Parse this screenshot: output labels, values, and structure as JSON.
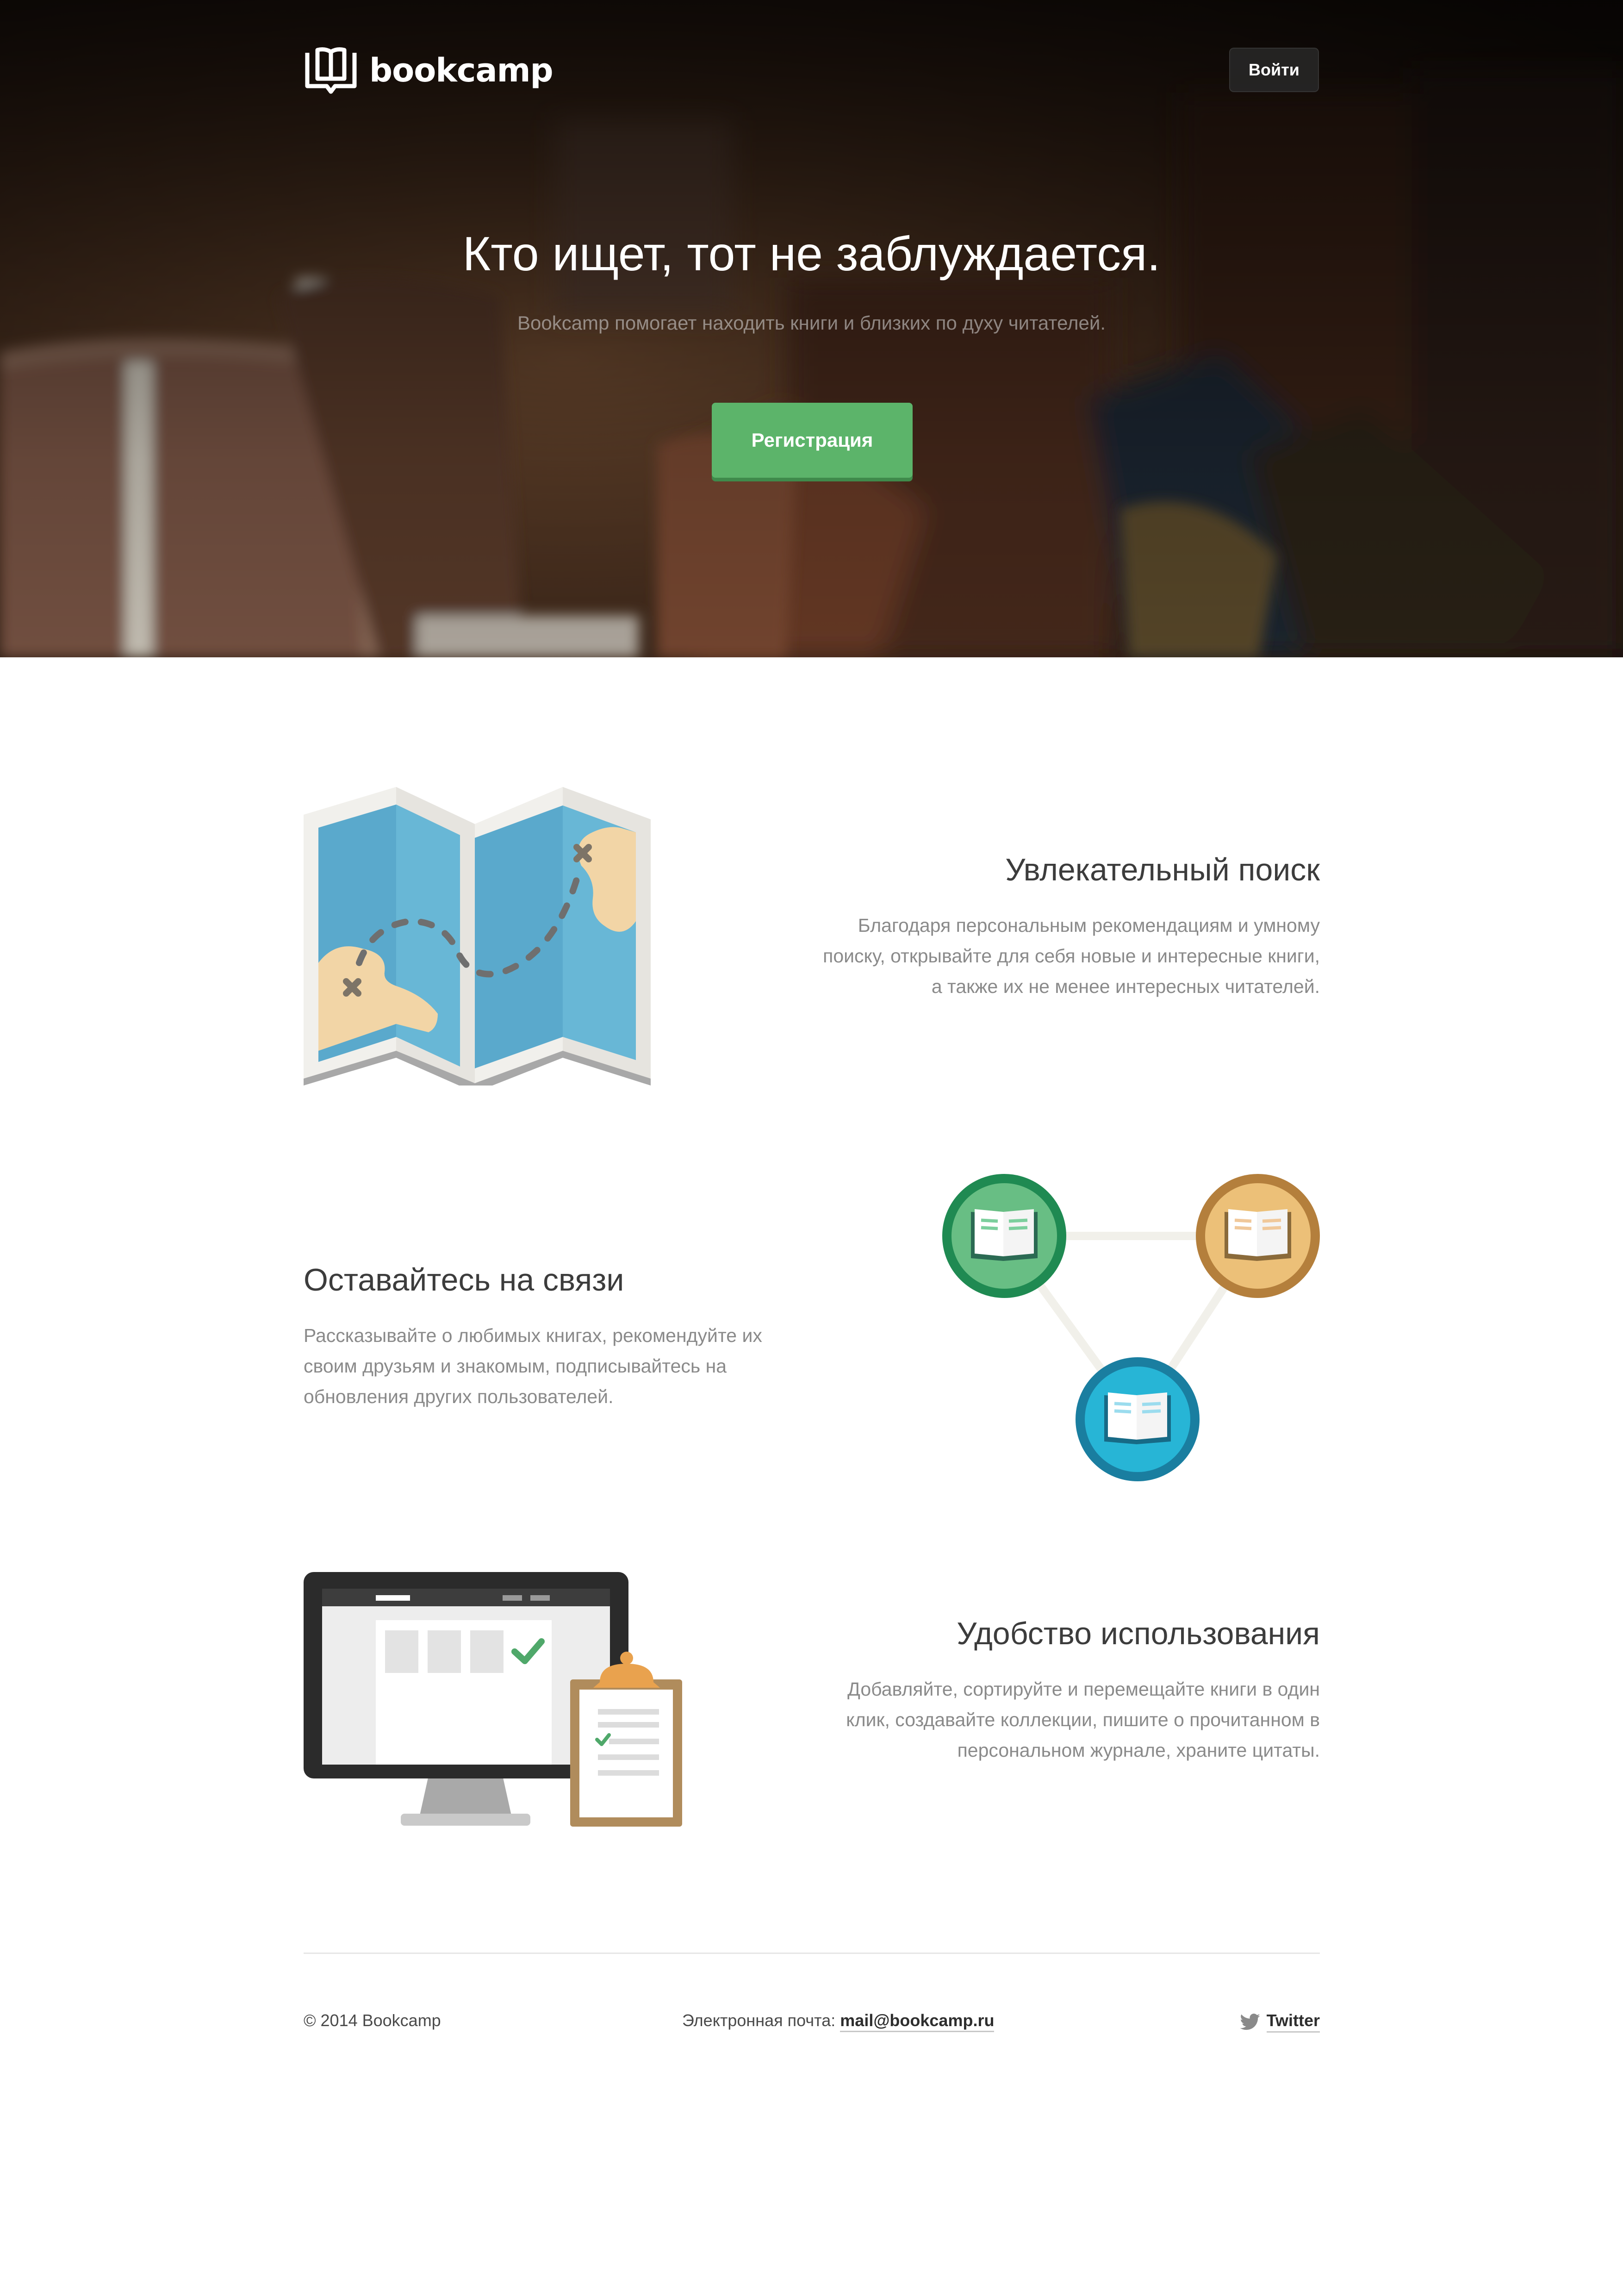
{
  "header": {
    "logo_text": "bookcamp",
    "logo_icon": "open-book-icon",
    "login_label": "Войти"
  },
  "hero": {
    "title": "Кто ищет, тот не заблуждается.",
    "subtitle": "Bookcamp помогает находить книги и близких по духу читателей.",
    "signup_label": "Регистрация",
    "accent_color": "#5cb46a"
  },
  "features": [
    {
      "title": "Увлекательный поиск",
      "description_lines": [
        "Благодаря персональным рекомендациям и умному",
        "поиску, открывайте для себя новые и интересные книги,",
        "а также их не менее интересных читателей."
      ],
      "icon": "treasure-map-icon"
    },
    {
      "title": "Оставайтесь на связи",
      "description_lines": [
        "Рассказывайте о любимых книгах, рекомендуйте их",
        "своим друзьям и знакомым, подписывайтесь на",
        "обновления других пользователей."
      ],
      "icon": "book-network-icon"
    },
    {
      "title": "Удобство использования",
      "description_lines": [
        "Добавляйте, сортируйте и перемещайте книги в один",
        "клик, создавайте коллекции, пишите о прочитанном в",
        "персональном журнале, храните цитаты."
      ],
      "icon": "monitor-clipboard-icon"
    }
  ],
  "footer": {
    "copyright": "© 2014 Bookcamp",
    "email_label": "Электронная почта:",
    "email": "mail@bookcamp.ru",
    "twitter_label": "Twitter",
    "twitter_icon": "twitter-bird-icon"
  }
}
